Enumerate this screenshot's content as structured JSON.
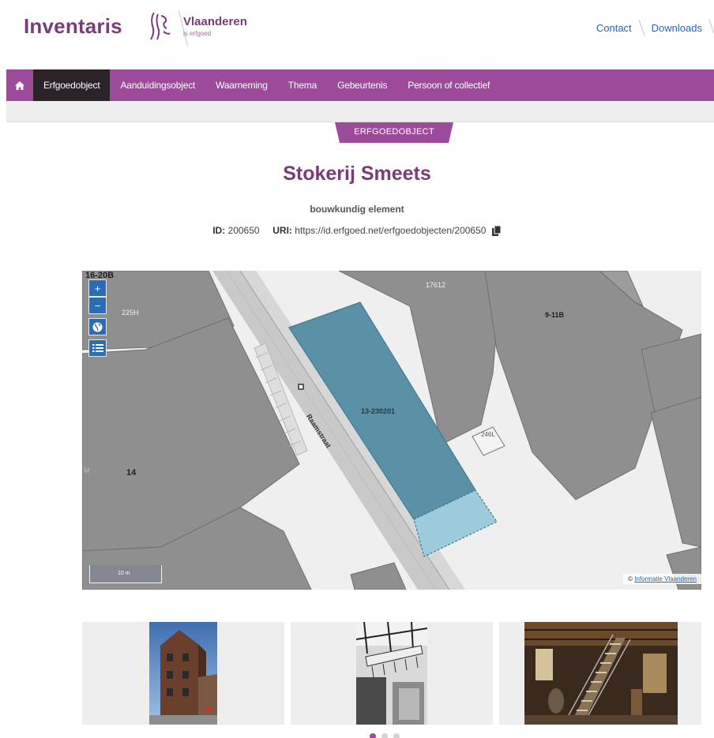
{
  "header": {
    "brand": "Inventaris",
    "logo_name": "Vlaanderen",
    "logo_sub": "is erfgoed",
    "links": [
      "Contact",
      "Downloads"
    ]
  },
  "nav": {
    "home_icon": "home-icon",
    "items": [
      {
        "label": "Erfgoedobject",
        "active": true
      },
      {
        "label": "Aanduidingsobject",
        "active": false
      },
      {
        "label": "Waarneming",
        "active": false
      },
      {
        "label": "Thema",
        "active": false
      },
      {
        "label": "Gebeurtenis",
        "active": false
      },
      {
        "label": "Persoon of collectief",
        "active": false
      }
    ]
  },
  "record": {
    "type_label": "ERFGOEDOBJECT",
    "title": "Stokerij Smeets",
    "subtitle": "bouwkundig element",
    "id_label": "ID:",
    "id_value": "200650",
    "uri_label": "URI:",
    "uri_value": "https://id.erfgoed.net/erfgoedobjecten/200650",
    "copy_icon": "copy-icon"
  },
  "map": {
    "controls": [
      {
        "name": "zoom-in-button",
        "glyph": "+"
      },
      {
        "name": "zoom-out-button",
        "glyph": "−"
      },
      {
        "name": "globe-button",
        "glyph": "globe-icon"
      },
      {
        "name": "layers-button",
        "glyph": "list-icon"
      }
    ],
    "labels": {
      "parcel_tl": "16-20B",
      "parcel_225h": "225H",
      "parcel_17612": "17612",
      "parcel_911b": "9-11B",
      "parcel_main": "13-230201",
      "parcel_246l": "246L",
      "parcel_14": "14",
      "parcel_m": "M",
      "street": "Raamstraat"
    },
    "scale": "10 m",
    "attribution_prefix": "©",
    "attribution_link": "Informatie Vlaanderen",
    "colors": {
      "highlight": "#5b91a6",
      "highlight_light": "#9ccbdc",
      "building": "#8f8f8f",
      "road": "#c9c9c9"
    }
  },
  "gallery": {
    "dots": [
      true,
      false,
      false
    ]
  },
  "colors": {
    "accent": "#9b4b99",
    "brand": "#7a3c78",
    "nav_active": "#2c2328",
    "link": "#1e64c8"
  }
}
